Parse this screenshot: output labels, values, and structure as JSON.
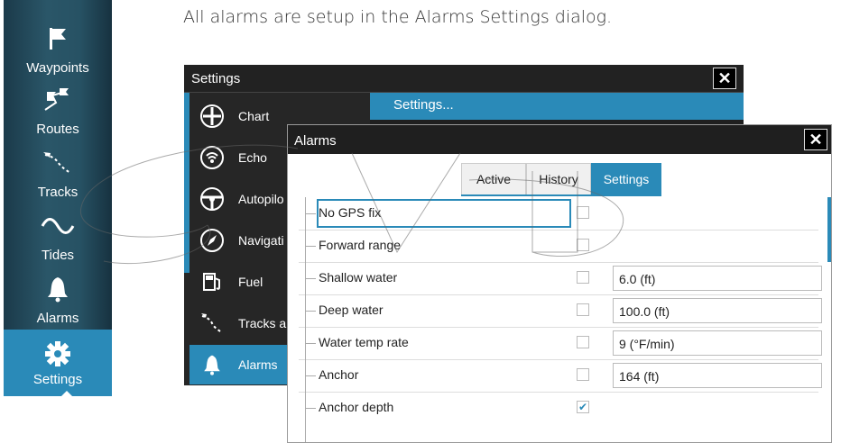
{
  "caption": "All alarms are setup in the Alarms Settings dialog.",
  "sidebar": {
    "items": [
      {
        "label": "Waypoints",
        "icon": "flag-icon"
      },
      {
        "label": "Routes",
        "icon": "route-icon"
      },
      {
        "label": "Tracks",
        "icon": "track-icon"
      },
      {
        "label": "Tides",
        "icon": "tide-wave-icon"
      },
      {
        "label": "Alarms",
        "icon": "bell-icon"
      },
      {
        "label": "Settings",
        "icon": "gear-icon",
        "selected": true
      }
    ]
  },
  "settings_window": {
    "title": "Settings",
    "close_symbol": "✕",
    "content_header": "Settings...",
    "menu": [
      {
        "label": "Chart",
        "icon": "chart-icon"
      },
      {
        "label": "Echo",
        "icon": "echo-icon"
      },
      {
        "label": "Autopilo",
        "icon": "steering-wheel-icon"
      },
      {
        "label": "Navigati",
        "icon": "compass-icon"
      },
      {
        "label": "Fuel",
        "icon": "fuel-pump-icon"
      },
      {
        "label": "Tracks a",
        "icon": "track-icon"
      },
      {
        "label": "Alarms",
        "icon": "bell-icon",
        "selected": true
      }
    ]
  },
  "alarms_dialog": {
    "title": "Alarms",
    "close_symbol": "✕",
    "tabs": [
      {
        "label": "Active"
      },
      {
        "label": "History"
      },
      {
        "label": "Settings",
        "active": true
      }
    ],
    "rows": [
      {
        "label": "No GPS fix",
        "checked": false,
        "value": null,
        "focused": true
      },
      {
        "label": "Forward range",
        "checked": false,
        "value": null
      },
      {
        "label": "Shallow water",
        "checked": false,
        "value": "6.0 (ft)"
      },
      {
        "label": "Deep water",
        "checked": false,
        "value": "100.0 (ft)"
      },
      {
        "label": "Water temp rate",
        "checked": false,
        "value": "9 (°F/min)"
      },
      {
        "label": "Anchor",
        "checked": false,
        "value": "164 (ft)"
      },
      {
        "label": "Anchor depth",
        "checked": true,
        "value": null
      }
    ],
    "check_symbol": "✔"
  },
  "colors": {
    "accent": "#2a8ab8",
    "dark": "#1f1f1f",
    "sidebar": "#275264"
  }
}
